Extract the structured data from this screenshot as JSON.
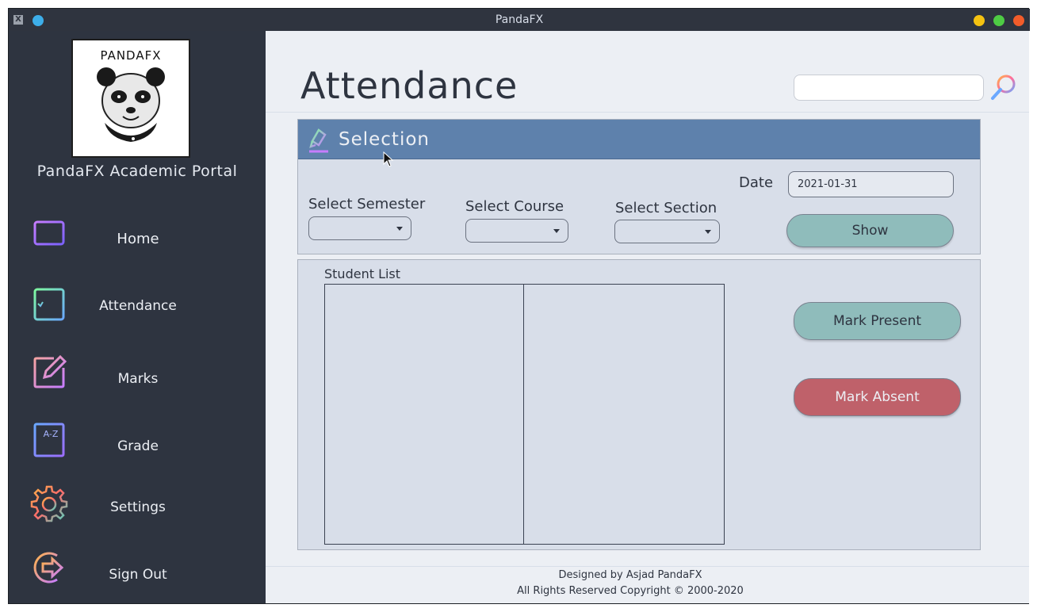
{
  "window": {
    "title": "PandaFX"
  },
  "sidebar": {
    "logo_text": "PANDAFX",
    "portal_title": "PandaFX Academic Portal",
    "items": [
      {
        "label": "Home",
        "icon": "monitor-icon"
      },
      {
        "label": "Attendance",
        "icon": "checklist-icon"
      },
      {
        "label": "Marks",
        "icon": "edit-icon"
      },
      {
        "label": "Grade",
        "icon": "grade-book-icon"
      },
      {
        "label": "Settings",
        "icon": "gear-icon"
      },
      {
        "label": "Sign Out",
        "icon": "sign-out-icon"
      }
    ]
  },
  "header": {
    "title": "Attendance",
    "search_value": ""
  },
  "selection": {
    "title": "Selection",
    "semester_label": "Select Semester",
    "course_label": "Select Course",
    "section_label": "Select Section",
    "date_label": "Date",
    "date_value": "2021-01-31",
    "show_label": "Show"
  },
  "students": {
    "list_label": "Student List",
    "mark_present_label": "Mark Present",
    "mark_absent_label": "Mark Absent"
  },
  "footer": {
    "line1": "Designed by Asjad PandaFX",
    "line2": "All Rights Reserved Copyright © 2000-2020"
  },
  "colors": {
    "sidebar_bg": "#2e3440",
    "main_bg": "#eceff4",
    "panel_bg": "#d8dee9",
    "header_blue": "#5e81ac",
    "teal_button": "#8fbcbb",
    "red_button": "#bf616a"
  }
}
